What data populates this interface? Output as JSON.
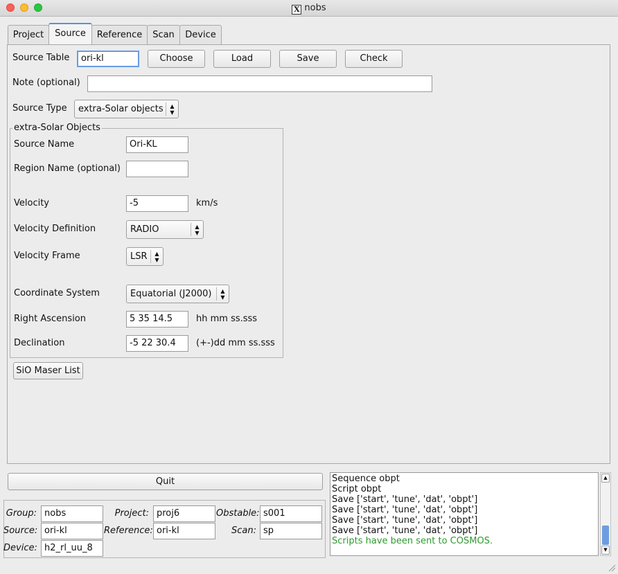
{
  "window": {
    "title": "nobs"
  },
  "tabs": [
    "Project",
    "Source",
    "Reference",
    "Scan",
    "Device"
  ],
  "source_table": {
    "label": "Source Table",
    "value": "ori-kl",
    "buttons": {
      "choose": "Choose",
      "load": "Load",
      "save": "Save",
      "check": "Check"
    }
  },
  "note": {
    "label": "Note (optional)",
    "value": ""
  },
  "source_type": {
    "label": "Source Type",
    "value": "extra-Solar objects"
  },
  "objects": {
    "title": "extra-Solar Objects",
    "source_name": {
      "label": "Source Name",
      "value": "Ori-KL"
    },
    "region_name": {
      "label": "Region Name (optional)",
      "value": ""
    },
    "velocity": {
      "label": "Velocity",
      "value": "-5",
      "unit": "km/s"
    },
    "velocity_definition": {
      "label": "Velocity Definition",
      "value": "RADIO"
    },
    "velocity_frame": {
      "label": "Velocity Frame",
      "value": "LSR"
    },
    "coordinate_system": {
      "label": "Coordinate System",
      "value": "Equatorial (J2000)"
    },
    "right_ascension": {
      "label": "Right Ascension",
      "value": "5 35 14.5",
      "unit": "hh mm ss.sss"
    },
    "declination": {
      "label": "Declination",
      "value": "-5 22 30.4",
      "unit": "(+-)dd mm ss.sss"
    }
  },
  "sio_button": "SiO Maser List",
  "quit_button": "Quit",
  "info": {
    "group": {
      "label": "Group:",
      "value": "nobs"
    },
    "project": {
      "label": "Project:",
      "value": "proj6"
    },
    "obstable": {
      "label": "Obstable:",
      "value": "s001"
    },
    "source": {
      "label": "Source:",
      "value": "ori-kl"
    },
    "reference": {
      "label": "Reference:",
      "value": "ori-kl"
    },
    "scan": {
      "label": "Scan:",
      "value": "sp"
    },
    "device": {
      "label": "Device:",
      "value": "h2_rl_uu_8"
    }
  },
  "log": [
    "Sequence obpt",
    "Script obpt",
    "Save ['start', 'tune', 'dat', 'obpt']",
    "Save ['start', 'tune', 'dat', 'obpt']",
    "Save ['start', 'tune', 'dat', 'obpt']",
    "Save ['start', 'tune', 'dat', 'obpt']",
    "Scripts have been sent to COSMOS."
  ],
  "colors": {
    "accent": "#5a8fd8",
    "log_success": "#2e9a2e"
  }
}
